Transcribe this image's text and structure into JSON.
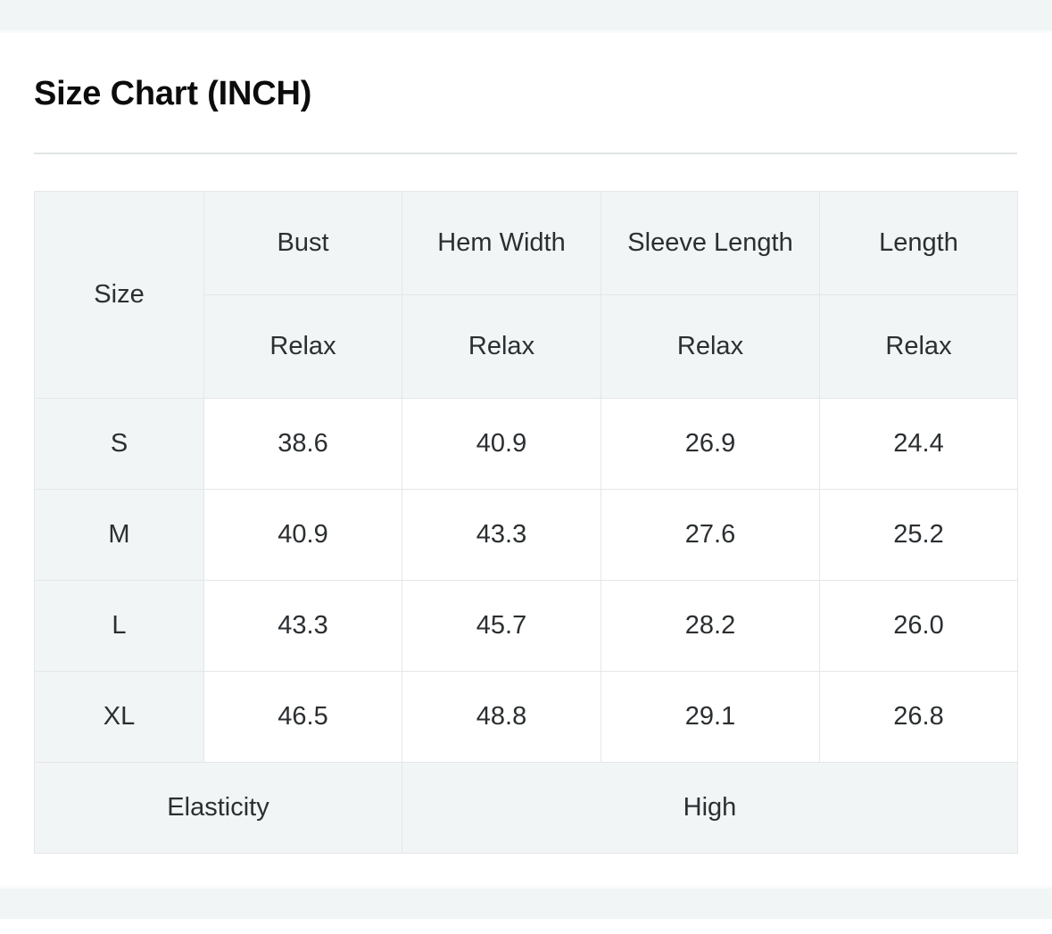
{
  "page": {
    "title": "Size Chart (INCH)"
  },
  "chart_data": {
    "type": "table",
    "title": "Size Chart (INCH)",
    "unit": "INCH",
    "column_headers": [
      "Size",
      "Bust",
      "Hem Width",
      "Sleeve Length",
      "Length"
    ],
    "sub_headers": [
      "Relax",
      "Relax",
      "Relax",
      "Relax"
    ],
    "categories": [
      "S",
      "M",
      "L",
      "XL"
    ],
    "series": [
      {
        "name": "Bust",
        "values": [
          38.6,
          40.9,
          43.3,
          46.5
        ]
      },
      {
        "name": "Hem Width",
        "values": [
          40.9,
          43.3,
          45.7,
          48.8
        ]
      },
      {
        "name": "Sleeve Length",
        "values": [
          26.9,
          27.6,
          28.2,
          29.1
        ]
      },
      {
        "name": "Length",
        "values": [
          24.4,
          25.2,
          26.0,
          26.8
        ]
      }
    ]
  },
  "table": {
    "header": {
      "size_label": "Size",
      "bust_label": "Bust",
      "hem_width_label": "Hem Width",
      "sleeve_length_label": "Sleeve Length",
      "length_label": "Length",
      "bust_fit": "Relax",
      "hem_width_fit": "Relax",
      "sleeve_length_fit": "Relax",
      "length_fit": "Relax"
    },
    "rows": [
      {
        "size": "S",
        "bust": "38.6",
        "hem_width": "40.9",
        "sleeve_length": "26.9",
        "length": "24.4"
      },
      {
        "size": "M",
        "bust": "40.9",
        "hem_width": "43.3",
        "sleeve_length": "27.6",
        "length": "25.2"
      },
      {
        "size": "L",
        "bust": "43.3",
        "hem_width": "45.7",
        "sleeve_length": "28.2",
        "length": "26.0"
      },
      {
        "size": "XL",
        "bust": "46.5",
        "hem_width": "48.8",
        "sleeve_length": "29.1",
        "length": "26.8"
      }
    ],
    "footer": {
      "elasticity_label": "Elasticity",
      "elasticity_value": "High"
    }
  },
  "colors": {
    "cell_header_bg": "#f2f5f6",
    "cell_value_bg": "#ffffff",
    "border": "#e4e6e7",
    "text": "#2b2f31",
    "title_text": "#0c0c0c",
    "page_band": "#f1f5f6"
  }
}
